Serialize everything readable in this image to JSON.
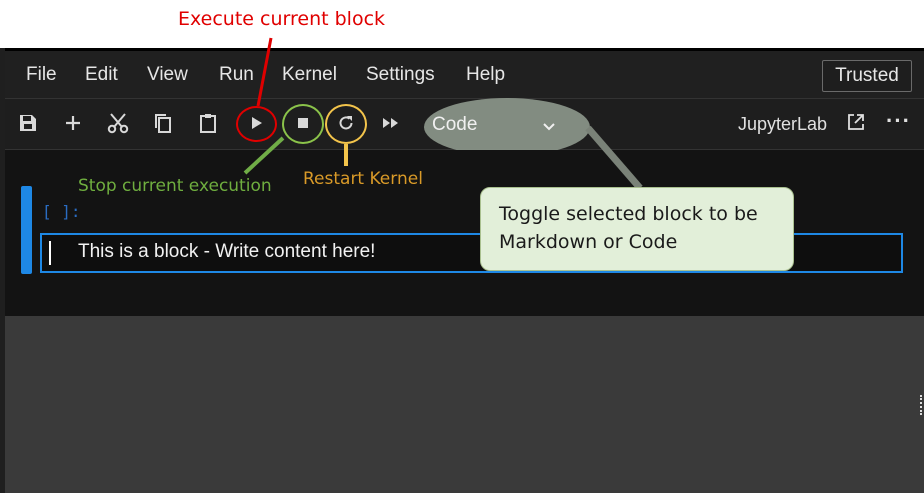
{
  "annotations": {
    "execute": "Execute current block",
    "stop": "Stop current execution",
    "restart": "Restart Kernel",
    "toggle": "Toggle selected block to be Markdown or Code"
  },
  "menubar": {
    "items": [
      "File",
      "Edit",
      "View",
      "Run",
      "Kernel",
      "Settings",
      "Help"
    ],
    "trusted": "Trusted"
  },
  "toolbar": {
    "icons": [
      "save-icon",
      "add-cell-icon",
      "cut-icon",
      "copy-icon",
      "paste-icon",
      "run-icon",
      "stop-icon",
      "restart-icon",
      "fast-forward-icon"
    ],
    "cell_type": "Code",
    "jupyterlab": "JupyterLab"
  },
  "cell": {
    "prompt": "[ ]:",
    "content": "This is a block - Write content here!"
  },
  "colors": {
    "execute": "#e00000",
    "stop": "#8bc34a",
    "restart": "#f3c44b",
    "accent": "#1e88e5"
  }
}
